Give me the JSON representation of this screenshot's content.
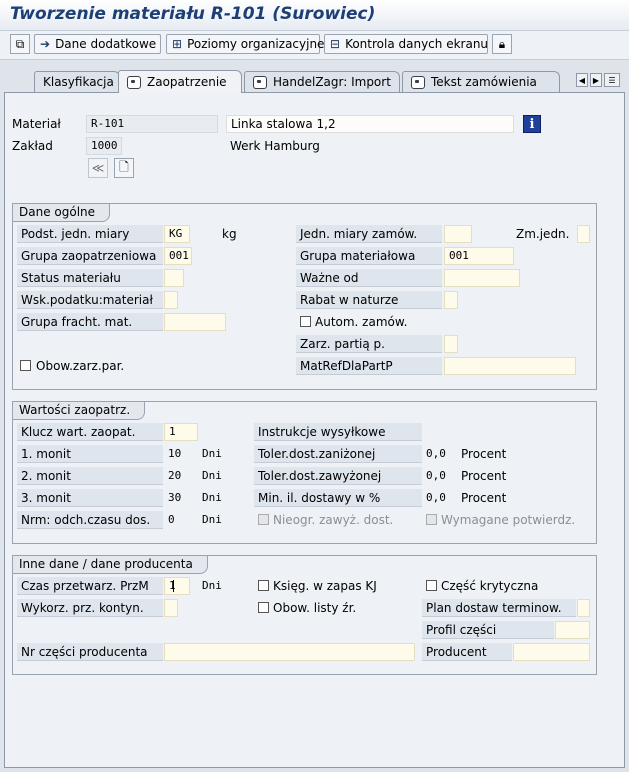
{
  "window": {
    "title": "Tworzenie materiału R-101 (Surowiec)"
  },
  "toolbar": {
    "buttons": [
      {
        "label": "Dane dodatkowe",
        "icon": "arrow-right-icon"
      },
      {
        "label": "Poziomy organizacyjne",
        "icon": "org-levels-icon"
      },
      {
        "label": "Kontrola danych ekranu",
        "icon": "check-data-icon"
      }
    ]
  },
  "tabs": [
    {
      "label": "Klasyfikacja",
      "active": false
    },
    {
      "label": "Zaopatrzenie",
      "active": true
    },
    {
      "label": "HandelZagr: Import",
      "active": false
    },
    {
      "label": "Tekst zamówienia",
      "active": false
    }
  ],
  "header": {
    "material_label": "Materiał",
    "material_value": "R-101",
    "material_desc": "Linka stalowa 1,2",
    "plant_label": "Zakład",
    "plant_value": "1000",
    "plant_desc": "Werk Hamburg"
  },
  "general": {
    "title": "Dane ogólne",
    "base_uom_label": "Podst. jedn. miary",
    "base_uom_value": "KG",
    "base_uom_text": "kg",
    "order_uom_label": "Jedn. miary zamów.",
    "var_uom_label": "Zm.jedn.",
    "purch_group_label": "Grupa zaopatrzeniowa",
    "purch_group_value": "001",
    "mat_group_label": "Grupa materiałowa",
    "mat_group_value": "001",
    "mat_status_label": "Status materiału",
    "valid_from_label": "Ważne od",
    "tax_ind_label": "Wsk.podatku:materiał",
    "discount_label": "Rabat w naturze",
    "freight_group_label": "Grupa fracht. mat.",
    "auto_po_label": "Autom. zamów.",
    "batch_mgmt_label": "Zarz. partią p.",
    "mandatory_mfr_label": "Obow.zarz.par.",
    "mfr_part_profile_label": "MatRefDlaPartP"
  },
  "purchasing": {
    "title": "Wartości zaopatrz.",
    "key_label": "Klucz wart. zaopat.",
    "key_value": "1",
    "shipping_label": "Instrukcje wysyłkowe",
    "rem1_label": "1. monit",
    "rem1_value": "10",
    "rem1_unit": "Dni",
    "rem2_label": "2. monit",
    "rem2_value": "20",
    "rem2_unit": "Dni",
    "rem3_label": "3. monit",
    "rem3_value": "30",
    "rem3_unit": "Dni",
    "under_tol_label": "Toler.dost.zaniżonej",
    "under_tol_value": "0,0",
    "under_tol_unit": "Procent",
    "over_tol_label": "Toler.dost.zawyżonej",
    "over_tol_value": "0,0",
    "over_tol_unit": "Procent",
    "min_qty_label": "Min. il. dostawy w %",
    "min_qty_value": "0,0",
    "min_qty_unit": "Procent",
    "dev_label": "Nrm: odch.czasu dos.",
    "dev_value": "0",
    "dev_unit": "Dni",
    "unlimited_label": "Nieogr. zawyż. dost.",
    "ack_label": "Wymagane potwierdz."
  },
  "other": {
    "title": "Inne dane / dane producenta",
    "gr_time_label": "Czas przetwarz. PrzM",
    "gr_time_value": "1",
    "gr_time_unit": "Dni",
    "post_insp_label": "Księg. w zapas KJ",
    "critical_label": "Część krytyczna",
    "quota_label": "Wykorz. prz. kontyn.",
    "source_list_label": "Obow. listy źr.",
    "sched_label": "Plan dostaw terminow.",
    "part_profile_label": "Profil części",
    "mfr_part_label": "Nr części producenta",
    "mfr_label": "Producent"
  },
  "colors": {
    "title": "#1d3f76",
    "input_bg": "#fefbea",
    "panel_bg": "#eef1f5"
  }
}
